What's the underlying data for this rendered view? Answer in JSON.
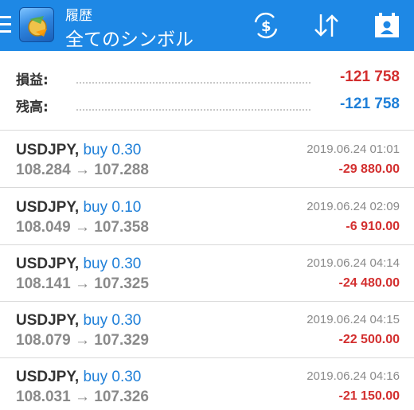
{
  "header": {
    "subtitle": "履歴",
    "title": "全てのシンボル",
    "icons": [
      "menu-icon",
      "app-logo-icon",
      "currency-exchange-icon",
      "sort-icon",
      "period-calendar-icon"
    ]
  },
  "summary": {
    "profit_label": "損益:",
    "profit_value": "-121 758",
    "balance_label": "残高:",
    "balance_value": "-121 758"
  },
  "colors": {
    "accent": "#1e88e5",
    "negative": "#d32f2f",
    "balance": "#1e7fd8",
    "buy": "#1e7fd8"
  },
  "trades": [
    {
      "symbol": "USDJPY,",
      "side": "buy 0.30",
      "open": "108.284",
      "arrow": "→",
      "close": "107.288",
      "time": "2019.06.24 01:01",
      "profit": "-29 880.00"
    },
    {
      "symbol": "USDJPY,",
      "side": "buy 0.10",
      "open": "108.049",
      "arrow": "→",
      "close": "107.358",
      "time": "2019.06.24 02:09",
      "profit": "-6 910.00"
    },
    {
      "symbol": "USDJPY,",
      "side": "buy 0.30",
      "open": "108.141",
      "arrow": "→",
      "close": "107.325",
      "time": "2019.06.24 04:14",
      "profit": "-24 480.00"
    },
    {
      "symbol": "USDJPY,",
      "side": "buy 0.30",
      "open": "108.079",
      "arrow": "→",
      "close": "107.329",
      "time": "2019.06.24 04:15",
      "profit": "-22 500.00"
    },
    {
      "symbol": "USDJPY,",
      "side": "buy 0.30",
      "open": "108.031",
      "arrow": "→",
      "close": "107.326",
      "time": "2019.06.24 04:16",
      "profit": "-21 150.00"
    }
  ]
}
